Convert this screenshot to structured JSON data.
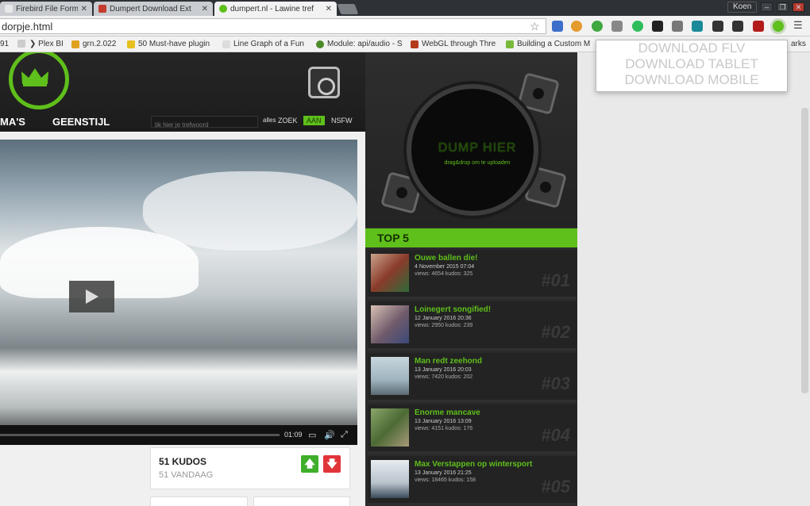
{
  "browser": {
    "tabs": [
      {
        "title": "Firebird File Format - G",
        "favicon_color": "#e8e8e8",
        "active": false
      },
      {
        "title": "Dumpert Download Ext",
        "favicon_color": "#c43b2f",
        "active": false
      },
      {
        "title": "dumpert.nl - Lawine tref",
        "favicon_color": "#5fbf1b",
        "active": true
      }
    ],
    "close_glyph": "✕",
    "user": "Koen",
    "window_buttons": [
      "–",
      "❐",
      "✕"
    ],
    "url": "dorpje.html",
    "star_glyph": "☆",
    "extensions": [
      {
        "icon": "bookmark-sync-icon",
        "color": "#3b6fc9"
      },
      {
        "icon": "cookie-icon",
        "color": "#e59a2e"
      },
      {
        "icon": "leaf-icon",
        "color": "#3fa83f"
      },
      {
        "icon": "paper-plane-icon",
        "color": "#888888"
      },
      {
        "icon": "spotify-icon",
        "color": "#2ebd59"
      },
      {
        "icon": "qr-icon",
        "color": "#222222"
      },
      {
        "icon": "cast-icon",
        "color": "#777777"
      },
      {
        "icon": "chart-icon",
        "color": "#1a8a9a"
      },
      {
        "icon": "pause-icon",
        "color": "#333333"
      },
      {
        "icon": "window-icon",
        "color": "#333333"
      },
      {
        "icon": "ublock-icon",
        "color": "#b31b1b"
      },
      {
        "icon": "dumpert-ext-icon",
        "color": "#5fbf1b"
      }
    ],
    "menu_glyph": "☰",
    "bookmarks": [
      {
        "label": "91",
        "color": ""
      },
      {
        "label": "",
        "color": "#cccccc"
      },
      {
        "label": "❯ Plex BI",
        "color": ""
      },
      {
        "label": "grn.2.022",
        "color": "#e0a020"
      },
      {
        "label": "50 Must-have plugin",
        "color": "#e8c020"
      },
      {
        "label": "Line Graph of a Fun",
        "color": "#dddddd"
      },
      {
        "label": "Module: api/audio - S",
        "color": "#4d8a2a"
      },
      {
        "label": "WebGL through Thre",
        "color": "#b53a1a"
      },
      {
        "label": "Building a Custom M",
        "color": "#7ab83a"
      },
      {
        "label": "arks",
        "color": ""
      }
    ]
  },
  "extension_popup": {
    "items": [
      "DOWNLOAD FLV",
      "DOWNLOAD TABLET",
      "DOWNLOAD MOBILE"
    ]
  },
  "site": {
    "nav": [
      "MA'S",
      "GEENSTIJL"
    ],
    "search_placeholder": "tik hier je trefwoord",
    "filters": {
      "alles": "alles",
      "zoek": "ZOEK",
      "aan": "AAN",
      "nsfw": "NSFW"
    },
    "player": {
      "time": "01:09",
      "volume_glyph": "🔊",
      "fullscreen_glyph": "⤢",
      "cc_glyph": "▭"
    },
    "kudos": {
      "count": "51 KUDOS",
      "today": "51 VANDAAG",
      "up_glyph": "🡅",
      "down_glyph": "🡇",
      "up_color": "#3fae2a",
      "down_color": "#e0353a"
    },
    "dump": {
      "title": "DUMP HIER",
      "subtitle": "drag&drop om te uploaden"
    },
    "top5": {
      "heading": "TOP 5",
      "items": [
        {
          "title": "Ouwe ballen die!",
          "date": "4 November 2015 07:04",
          "stats": "views: 4654 kudos: 325",
          "rank": "#01",
          "thumb": "#8a3b2a"
        },
        {
          "title": "Loinegert songified!",
          "date": "12 January 2016 20:36",
          "stats": "views: 2950 kudos: 239",
          "rank": "#02",
          "thumb": "#6f5a6a"
        },
        {
          "title": "Man redt zeehond",
          "date": "13 January 2016 20:03",
          "stats": "views: 7420 kudos: 202",
          "rank": "#03",
          "thumb": "#9fb4bf"
        },
        {
          "title": "Enorme mancave",
          "date": "13 January 2016 13:09",
          "stats": "views: 4151 kudos: 176",
          "rank": "#04",
          "thumb": "#4c6a34"
        },
        {
          "title": "Max Verstappen op wintersport",
          "date": "13 January 2016 21:25",
          "stats": "views: 18465 kudos: 158",
          "rank": "#05",
          "thumb": "#b9c3cc"
        }
      ]
    }
  }
}
